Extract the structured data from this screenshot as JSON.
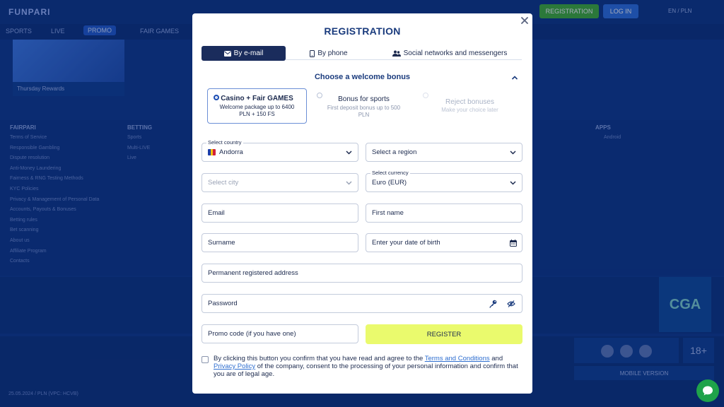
{
  "background": {
    "logo": "FUNPARI",
    "nav": [
      "SPORTS",
      "LIVE",
      "PROMO",
      "FAIR GAMES"
    ],
    "registration_button": "REGISTRATION",
    "login_button": "LOG IN",
    "language": "EN / PLN",
    "banner_caption": "Thursday Rewards",
    "footer_col1_title": "FAIRPARI",
    "footer_col1_links": [
      "Terms of Service",
      "Responsible Gambling",
      "Dispute resolution",
      "Anti-Money Laundering",
      "Fairness & RNG Testing Methods",
      "KYC Policies",
      "Privacy & Management of Personal Data",
      "Accounts, Payouts & Bonuses",
      "Betting rules",
      "Bet scanning",
      "About us",
      "Affiliate Program",
      "Contacts"
    ],
    "footer_col2_title": "BETTING",
    "footer_col2_links": [
      "Sports",
      "Multi-LIVE",
      "Live"
    ],
    "footer_col3_title": "APPS",
    "footer_col3_links": [
      "Android"
    ],
    "cga_logo": "CGA",
    "age_badge": "18+",
    "mobile_version": "MOBILE VERSION",
    "version_line": "25.05.2024 / PLN (VPC: HCVB)"
  },
  "modal": {
    "title": "REGISTRATION",
    "tabs": [
      {
        "label": "By e-mail",
        "icon": "envelope-icon"
      },
      {
        "label": "By phone",
        "icon": "phone-icon"
      },
      {
        "label": "Social networks and messengers",
        "icon": "users-icon"
      }
    ],
    "bonus_heading": "Choose a welcome bonus",
    "bonuses": [
      {
        "title": "Casino + Fair GAMES",
        "subtitle": "Welcome package up to 6400 PLN + 150 FS",
        "selected": true
      },
      {
        "title": "Bonus for sports",
        "subtitle": "First deposit bonus up to 500 PLN",
        "selected": false
      },
      {
        "title": "Reject bonuses",
        "subtitle": "Make your choice later",
        "selected": false
      }
    ],
    "country": {
      "label": "Select country",
      "value": "Andorra"
    },
    "region": {
      "placeholder": "Select a region"
    },
    "city": {
      "placeholder": "Select city"
    },
    "currency": {
      "label": "Select currency",
      "value": "Euro (EUR)"
    },
    "email": {
      "placeholder": "Email"
    },
    "first_name": {
      "placeholder": "First name"
    },
    "surname": {
      "placeholder": "Surname"
    },
    "dob": {
      "placeholder": "Enter your date of birth"
    },
    "address": {
      "placeholder": "Permanent registered address"
    },
    "password": {
      "placeholder": "Password"
    },
    "promo": {
      "placeholder": "Promo code (if you have one)"
    },
    "register_button": "REGISTER",
    "consent": {
      "prefix": "By clicking this button you confirm that you have read and agree to the ",
      "terms_link": "Terms and Conditions",
      "and": " and ",
      "privacy_link": "Privacy Policy",
      "suffix": " of the company, consent to the processing of your personal information and confirm that you are of legal age."
    }
  },
  "colors": {
    "accent": "#1a2c5c",
    "register": "#eafa6d",
    "chat": "#1fa34a",
    "link": "#2f6fd0"
  }
}
